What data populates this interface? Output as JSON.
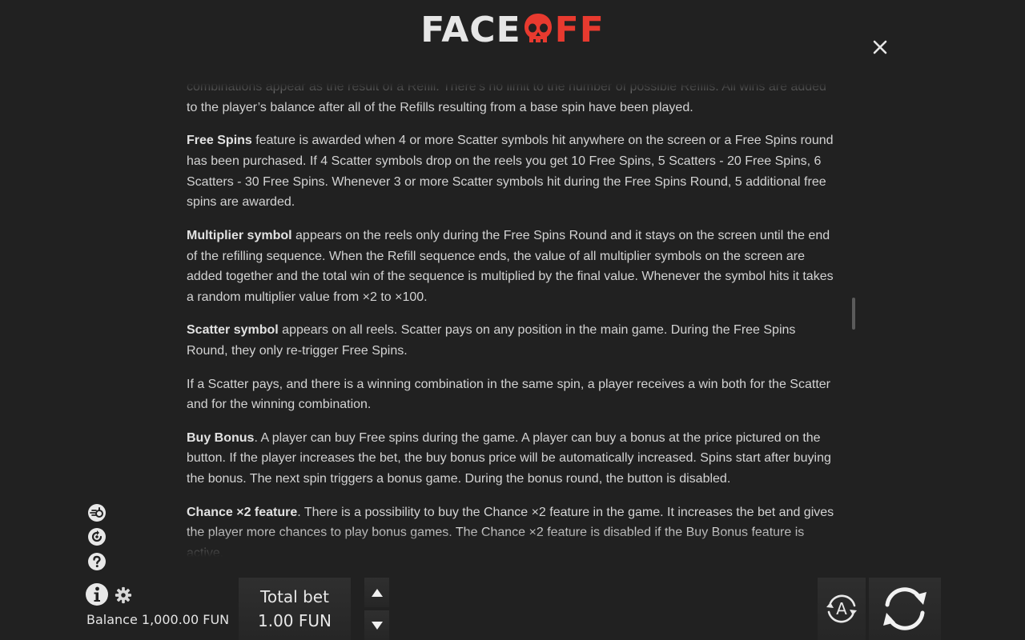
{
  "logo": {
    "part1": "FACE",
    "part2": "FF"
  },
  "rules": {
    "paragraphs": [
      {
        "bold": "",
        "text": "combinations appear as the result of a Refill. There’s no limit to the number of possible Refills. All wins are added to the player’s balance after all of the Refills resulting from a base spin have been played."
      },
      {
        "bold": "Free Spins",
        "text": " feature is awarded when 4 or more Scatter symbols hit anywhere on the screen or a Free Spins round has been purchased. If 4 Scatter symbols drop on the reels you get 10 Free Spins, 5 Scatters - 20 Free Spins, 6 Scatters - 30 Free Spins. Whenever 3 or more Scatter symbols hit during the Free Spins Round, 5 additional free spins are awarded."
      },
      {
        "bold": "Multiplier symbol",
        "text": " appears on the reels only during the Free Spins Round and it stays on the screen until the end of the refilling sequence. When the Refill sequence ends, the value of all multiplier symbols on the screen are added together and the total win of the sequence is multiplied by the final value. Whenever the symbol hits it takes a random multiplier value from ×2 to ×100."
      },
      {
        "bold": "Scatter symbol",
        "text": " appears on all reels. Scatter pays on any position in the main game. During the Free Spins Round, they only re-trigger Free Spins."
      },
      {
        "bold": "",
        "text": "If a Scatter pays, and there is a winning combination in the same spin, a player receives a win both for the Scatter and for the winning combination."
      },
      {
        "bold": "Buy Bonus",
        "text": ". A player can buy Free spins during the game. A player can buy a bonus at the price pictured on the button. If the player increases the bet, the buy bonus price will be automatically increased. Spins start after buying the bonus. The next spin triggers a bonus game. During the bonus round, the button is disabled."
      },
      {
        "bold": "Chance ×2 feature",
        "text": ". There is a possibility to buy the Chance ×2 feature in the game. It increases the bet and gives the player more chances to play bonus games. The Chance ×2 feature is disabled if the Buy Bonus feature is active."
      }
    ]
  },
  "footer": {
    "balance_label": "Balance",
    "balance_value": "1,000.00 FUN",
    "total_bet_label": "Total bet",
    "total_bet_value": "1.00 FUN",
    "auto_label": "A"
  },
  "icons": {
    "close": "close-icon",
    "turbo": "turbo-spin-icon",
    "history": "history-icon",
    "help": "question-icon",
    "info": "info-icon",
    "settings": "gear-icon",
    "bet_up": "arrow-up-icon",
    "bet_down": "arrow-down-icon",
    "autoplay": "autoplay-icon",
    "spin": "spin-icon"
  },
  "colors": {
    "background": "#212121",
    "logo_accent": "#e83a2f",
    "text": "#d3d3d3"
  }
}
